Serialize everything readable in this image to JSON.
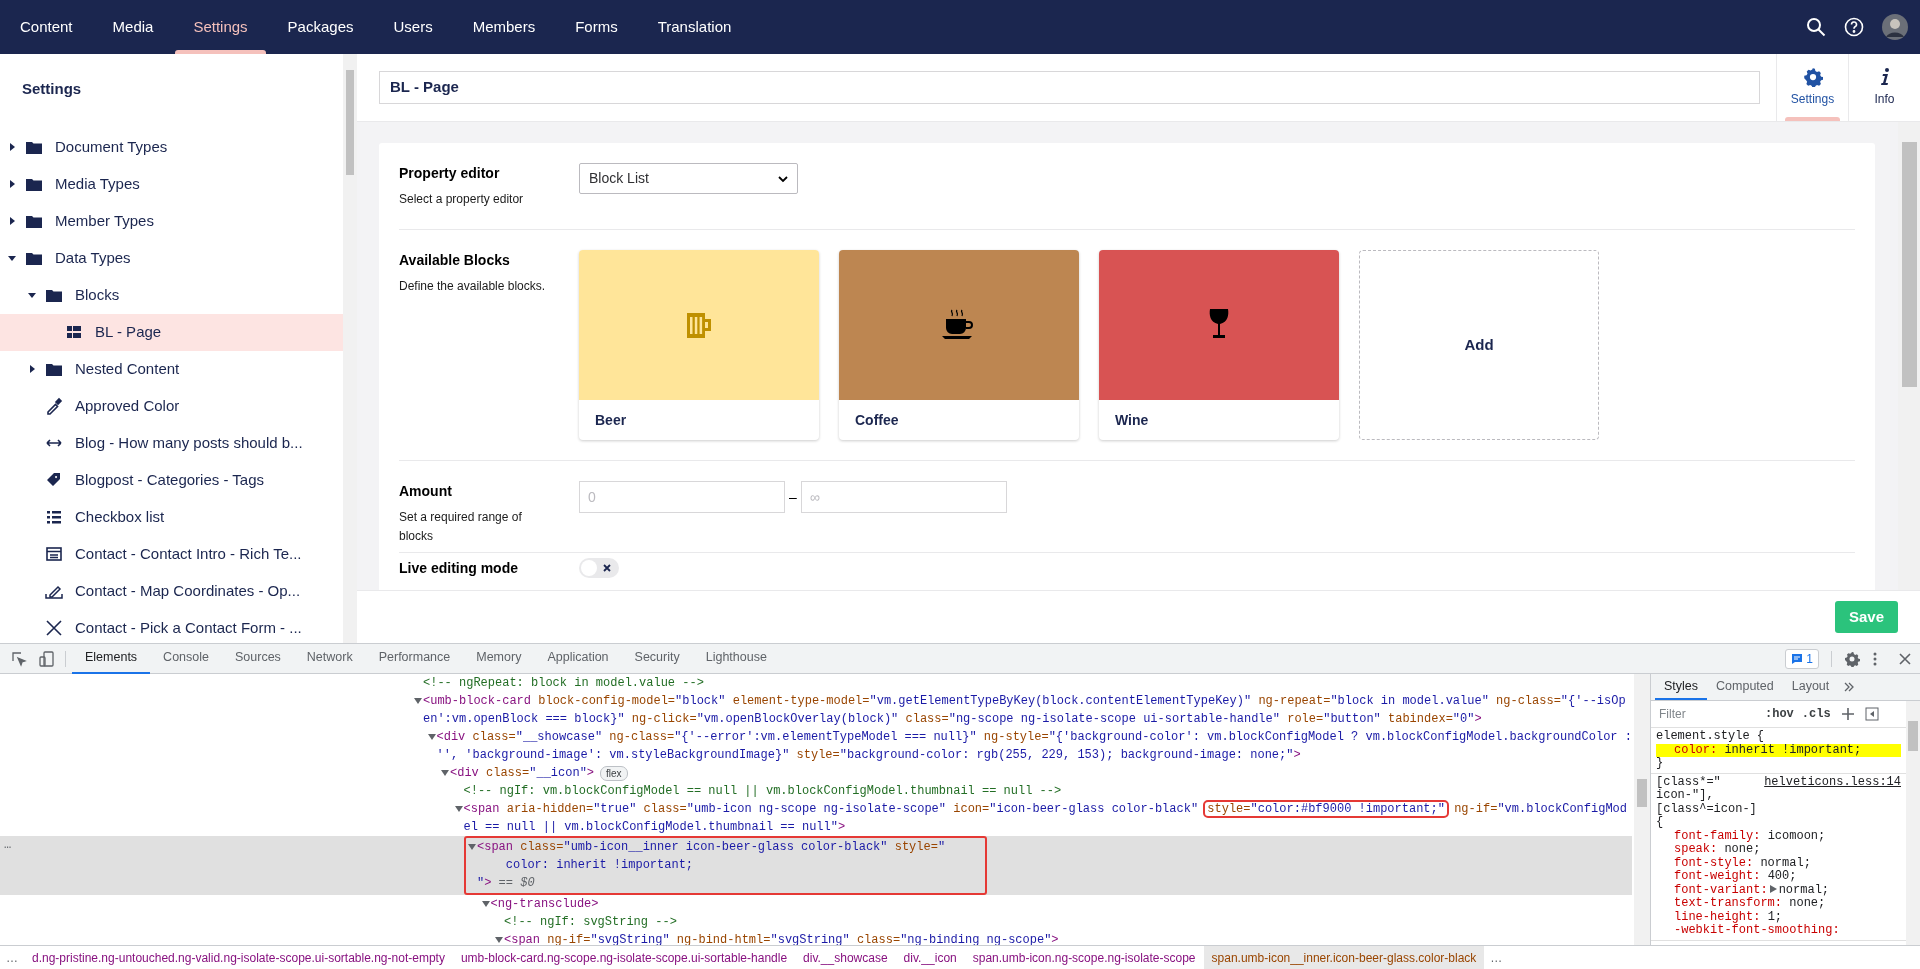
{
  "top_nav": {
    "tabs": [
      {
        "label": "Content",
        "selected": false
      },
      {
        "label": "Media",
        "selected": false
      },
      {
        "label": "Settings",
        "selected": true
      },
      {
        "label": "Packages",
        "selected": false
      },
      {
        "label": "Users",
        "selected": false
      },
      {
        "label": "Members",
        "selected": false
      },
      {
        "label": "Forms",
        "selected": false
      },
      {
        "label": "Translation",
        "selected": false
      }
    ]
  },
  "sidebar": {
    "title": "Settings",
    "items": [
      {
        "label": "Document Types",
        "kind": "folder",
        "expanded": false,
        "selected": false
      },
      {
        "label": "Media Types",
        "kind": "folder",
        "expanded": false,
        "selected": false
      },
      {
        "label": "Member Types",
        "kind": "folder",
        "expanded": false,
        "selected": false
      },
      {
        "label": "Data Types",
        "kind": "folder",
        "expanded": true,
        "selected": false,
        "children": [
          {
            "label": "Blocks",
            "kind": "folder",
            "expanded": true,
            "selected": false,
            "children": [
              {
                "label": "BL - Page",
                "kind": "blocklist",
                "selected": true
              }
            ]
          },
          {
            "label": "Nested Content",
            "kind": "folder",
            "expanded": false,
            "selected": false
          },
          {
            "label": "Approved Color",
            "kind": "colorpicker",
            "selected": false
          },
          {
            "label": "Blog - How many posts should b...",
            "kind": "slider",
            "selected": false
          },
          {
            "label": "Blogpost - Categories - Tags",
            "kind": "tags",
            "selected": false
          },
          {
            "label": "Checkbox list",
            "kind": "checkboxlist",
            "selected": false
          },
          {
            "label": "Contact - Contact Intro - Rich Te...",
            "kind": "richtext",
            "selected": false
          },
          {
            "label": "Contact - Map Coordinates - Op...",
            "kind": "map",
            "selected": false
          },
          {
            "label": "Contact - Pick a Contact Form - ...",
            "kind": "formpicker",
            "selected": false
          }
        ]
      }
    ]
  },
  "editor": {
    "name": "BL - Page",
    "apps": [
      {
        "label": "Settings",
        "selected": true
      },
      {
        "label": "Info",
        "selected": false
      }
    ],
    "properties": [
      {
        "kind": "select",
        "label": "Property editor",
        "description": "Select a property editor",
        "value": "Block List"
      },
      {
        "kind": "blocks",
        "label": "Available Blocks",
        "description": "Define the available blocks.",
        "add_label": "Add",
        "blocks": [
          {
            "name": "Beer",
            "color": "#ffe599",
            "icon": {
              "color": "#bf9000"
            }
          },
          {
            "name": "Coffee",
            "color": "#bd8651",
            "icon": {
              "color": "#000000"
            }
          },
          {
            "name": "Wine",
            "color": "#d85353",
            "icon": {
              "color": "#000000"
            }
          }
        ]
      },
      {
        "kind": "range",
        "label": "Amount",
        "description": "Set a required range of blocks",
        "min_placeholder": "0",
        "separator": "–",
        "max_placeholder": "∞"
      },
      {
        "kind": "toggle",
        "label": "Live editing mode",
        "on": false
      }
    ],
    "save_button": "Save"
  },
  "devtools": {
    "tabs": [
      {
        "label": "Elements",
        "selected": true
      },
      {
        "label": "Console",
        "selected": false
      },
      {
        "label": "Sources",
        "selected": false
      },
      {
        "label": "Network",
        "selected": false
      },
      {
        "label": "Performance",
        "selected": false
      },
      {
        "label": "Memory",
        "selected": false
      },
      {
        "label": "Application",
        "selected": false
      },
      {
        "label": "Security",
        "selected": false
      },
      {
        "label": "Lighthouse",
        "selected": false
      }
    ],
    "issues_count": "1",
    "elements": {
      "gutter": "…",
      "nodes": [
        {
          "comment": "<!-- ngRepeat: block in model.value -->",
          "selected": false
        },
        {
          "tag": "<umb-block-card",
          "close": ">",
          "expanded": true,
          "selected": false,
          "attrs": [
            {
              "name": "block-config-model=",
              "value": "\"block\"",
              "highlighted": false
            },
            {
              "name": "element-type-model=",
              "value": "\"vm.getElementTypeByKey(block.contentElementTypeKey)\"",
              "highlighted": false
            },
            {
              "name": "ng-repeat=",
              "value": "\"block in model.value\"",
              "highlighted": false
            },
            {
              "name": "ng-class=",
              "value": "\"{'--isOpen':vm.openBlock === block}\"",
              "highlighted": false
            },
            {
              "name": "ng-click=",
              "value": "\"vm.openBlockOverlay(block)\"",
              "highlighted": false
            },
            {
              "name": "class=",
              "value": "\"ng-scope ng-isolate-scope ui-sortable-handle\"",
              "highlighted": false
            },
            {
              "name": "role=",
              "value": "\"button\"",
              "highlighted": false
            },
            {
              "name": "tabindex=",
              "value": "\"0\"",
              "highlighted": false
            }
          ],
          "children": [
            {
              "tag": "<div",
              "close": ">",
              "expanded": true,
              "selected": false,
              "attrs": [
                {
                  "name": "class=",
                  "value": "\"__showcase\"",
                  "highlighted": false
                },
                {
                  "name": "ng-class=",
                  "value": "\"{'--error':vm.elementTypeModel === null}\"",
                  "highlighted": false
                },
                {
                  "name": "ng-style=",
                  "value": "\"{'background-color': vm.blockConfigModel ? vm.blockConfigModel.backgroundColor : '', 'background-image': vm.styleBackgroundImage}\"",
                  "highlighted": false
                },
                {
                  "name": "style=",
                  "value": "\"background-color: rgb(255, 229, 153); background-image: none;\"",
                  "highlighted": false
                }
              ],
              "children": [
                {
                  "tag": "<div",
                  "close": ">",
                  "badge": "flex",
                  "expanded": true,
                  "selected": false,
                  "attrs": [
                    {
                      "name": "class=",
                      "value": "\"__icon\"",
                      "highlighted": false
                    }
                  ],
                  "children": [
                    {
                      "comment": "<!-- ngIf: vm.blockConfigModel == null || vm.blockConfigModel.thumbnail == null -->",
                      "selected": false
                    },
                    {
                      "tag": "<span",
                      "close": ">",
                      "expanded": true,
                      "selected": false,
                      "attrs": [
                        {
                          "name": "aria-hidden=",
                          "value": "\"true\""
                        },
                        {
                          "name": "class=",
                          "value": "\"umb-icon ng-scope ng-isolate-scope\""
                        },
                        {
                          "name": "icon=",
                          "value": "\"icon-beer-glass color-black\""
                        },
                        {
                          "name": "style=",
                          "value": "\"color:#bf9000 !important;\"",
                          "highlighted": true
                        },
                        {
                          "name": "ng-if=",
                          "value": "\"vm.blockConfigModel == null || vm.blockConfigModel.thumbnail == null\""
                        }
                      ],
                      "children": [
                        {
                          "tag": "<span",
                          "close": ">",
                          "suffix": "== $0",
                          "expanded": true,
                          "selected": true,
                          "attrs": [
                            {
                              "name": "class=",
                              "value": "\"umb-icon__inner icon-beer-glass color-black\"",
                              "highlighted": false
                            },
                            {
                              "name": "style=",
                              "value": "\"\n    color: inherit !important;\n\"",
                              "highlighted": false
                            }
                          ],
                          "children": [
                            {
                              "tag": "<ng-transclude",
                              "close": ">",
                              "expanded": true,
                              "selected": false,
                              "children": [
                                {
                                  "comment": "<!-- ngIf: svgString -->",
                                  "selected": false
                                },
                                {
                                  "tag": "<span",
                                  "close": ">",
                                  "expanded": true,
                                  "selected": false,
                                  "attrs": [
                                    {
                                      "name": "ng-if=",
                                      "value": "\"svgString\"",
                                      "highlighted": false
                                    },
                                    {
                                      "name": "ng-bind-html=",
                                      "value": "\"svgString\"",
                                      "highlighted": false
                                    },
                                    {
                                      "name": "class=",
                                      "value": "\"ng-binding ng-scope\"",
                                      "highlighted": false
                                    }
                                  ]
                                }
                              ]
                            }
                          ]
                        }
                      ]
                    }
                  ]
                }
              ]
            }
          ]
        }
      ]
    },
    "styles": {
      "tabs": [
        {
          "label": "Styles",
          "selected": true
        },
        {
          "label": "Computed",
          "selected": false
        },
        {
          "label": "Layout",
          "selected": false
        }
      ],
      "filter_placeholder": "Filter",
      "toggles": [
        ":hov",
        ".cls"
      ],
      "rules": [
        {
          "selector": "element.style {",
          "close": "}",
          "props": [
            {
              "name": "color:",
              "value": "inherit !important;",
              "highlighted": true,
              "expandable": false
            }
          ]
        },
        {
          "selector": "[class*=\" icon-\"], [class^=icon-] {",
          "source": "helveticons.less:14",
          "props": [
            {
              "name": "font-family:",
              "value": "icomoon;",
              "highlighted": false,
              "expandable": false
            },
            {
              "name": "speak:",
              "value": "none;",
              "highlighted": false,
              "expandable": false
            },
            {
              "name": "font-style:",
              "value": "normal;",
              "highlighted": false,
              "expandable": false
            },
            {
              "name": "font-weight:",
              "value": "400;",
              "highlighted": false,
              "expandable": false
            },
            {
              "name": "font-variant:",
              "value": "normal;",
              "highlighted": false,
              "expandable": true
            },
            {
              "name": "text-transform:",
              "value": "none;",
              "highlighted": false,
              "expandable": false
            },
            {
              "name": "line-height:",
              "value": "1;",
              "highlighted": false,
              "expandable": false
            },
            {
              "name": "-webkit-font-smoothing:",
              "highlighted": false,
              "expandable": false
            }
          ]
        }
      ]
    },
    "breadcrumbs": {
      "leading": "…",
      "trailing": "…",
      "items": [
        {
          "label": "d.ng-pristine.ng-untouched.ng-valid.ng-isolate-scope.ui-sortable.ng-not-empty",
          "selected": false
        },
        {
          "label": "umb-block-card.ng-scope.ng-isolate-scope.ui-sortable-handle",
          "selected": false
        },
        {
          "label": "div.__showcase",
          "selected": false
        },
        {
          "label": "div.__icon",
          "selected": false
        },
        {
          "label": "span.umb-icon.ng-scope.ng-isolate-scope",
          "selected": false
        },
        {
          "label": "span.umb-icon__inner.icon-beer-glass.color-black",
          "selected": true
        }
      ]
    }
  }
}
